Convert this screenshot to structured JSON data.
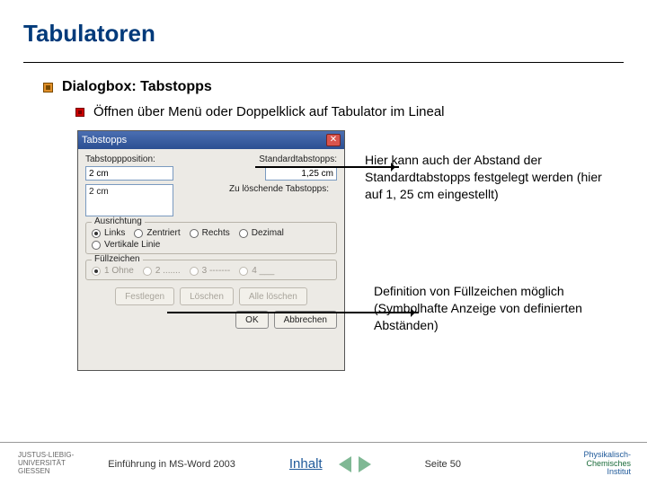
{
  "slide": {
    "title": "Tabulatoren",
    "bullet1": "Dialogbox: Tabstopps",
    "bullet2": "Öffnen über Menü oder Doppelklick auf Tabulator im Lineal"
  },
  "dialog": {
    "title": "Tabstopps",
    "close": "✕",
    "pos_label": "Tabstoppposition:",
    "pos_value": "2 cm",
    "def_label": "Standardtabstopps:",
    "def_value": "1,25 cm",
    "list_item": "2 cm",
    "del_label": "Zu löschende Tabstopps:",
    "group_align": "Ausrichtung",
    "align": {
      "links": "Links",
      "zentriert": "Zentriert",
      "rechts": "Rechts",
      "dezimal": "Dezimal",
      "vert": "Vertikale Linie"
    },
    "group_fill": "Füllzeichen",
    "fill": {
      "o1": "1 Ohne",
      "o2": "2 .......",
      "o3": "3 -------",
      "o4": "4 ___"
    },
    "btn": {
      "set": "Festlegen",
      "del": "Löschen",
      "delall": "Alle löschen",
      "ok": "OK",
      "cancel": "Abbrechen"
    }
  },
  "notes": {
    "n1": "Hier kann auch der Abstand der Standardtabstopps festgelegt werden (hier auf 1, 25 cm eingestellt)",
    "n2": "Definition von Füllzeichen möglich (Symbolhafte Anzeige von definierten Abständen)"
  },
  "footer": {
    "uni": "JUSTUS-LIEBIG-\nUNIVERSITÄT\nGIESSEN",
    "course": "Einführung in MS-Word 2003",
    "inhalt": "Inhalt",
    "page": "Seite 50",
    "inst1": "Physikalisch-",
    "inst2": "Chemisches",
    "inst3": "Institut"
  }
}
